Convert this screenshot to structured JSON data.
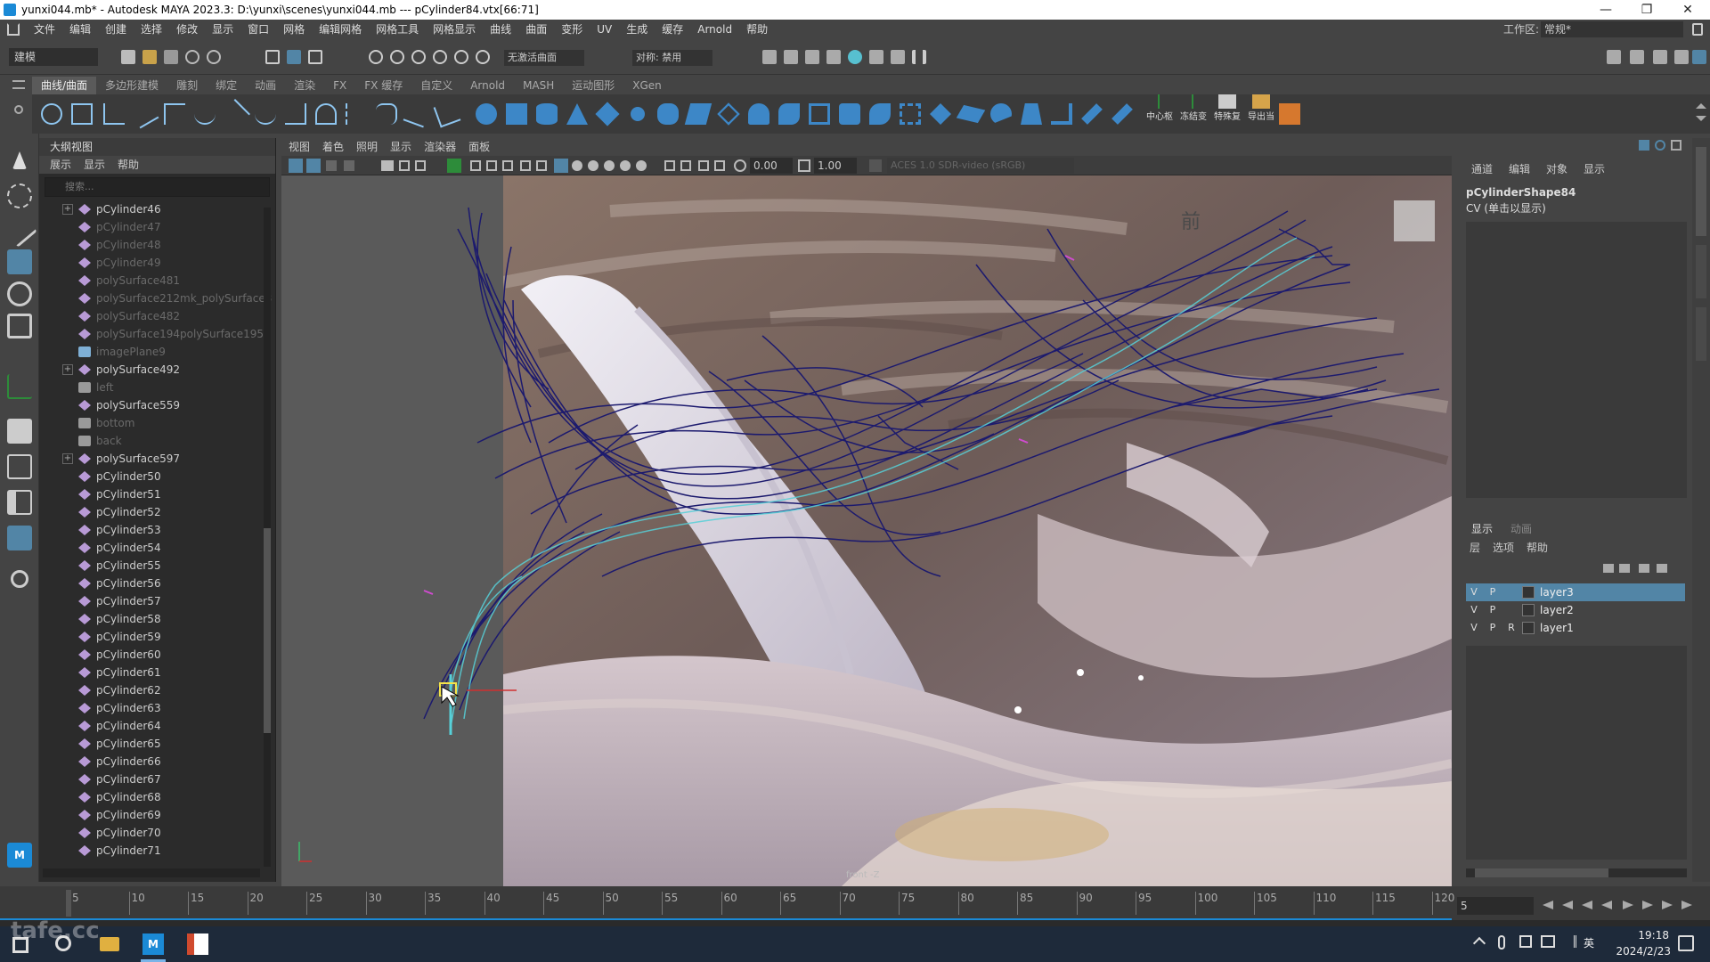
{
  "window": {
    "title": "yunxi044.mb* - Autodesk MAYA 2023.3: D:\\yunxi\\scenes\\yunxi044.mb  ---  pCylinder84.vtx[66:71]",
    "minimize": "—",
    "maximize": "❐",
    "close": "✕"
  },
  "menubar": [
    "文件",
    "编辑",
    "创建",
    "选择",
    "修改",
    "显示",
    "窗口",
    "网格",
    "编辑网格",
    "网格工具",
    "网格显示",
    "曲线",
    "曲面",
    "变形",
    "UV",
    "生成",
    "缓存",
    "Arnold",
    "帮助"
  ],
  "workspace": {
    "label": "工作区:",
    "value": "常规*"
  },
  "statusline": {
    "mode": "建模",
    "live_surface": "无激活曲面",
    "symmetry": "对称: 禁用"
  },
  "shelf_tabs": [
    "曲线/曲面",
    "多边形建模",
    "雕刻",
    "绑定",
    "动画",
    "渲染",
    "FX",
    "FX 缓存",
    "自定义",
    "Arnold",
    "MASH",
    "运动图形",
    "XGen"
  ],
  "shelf_text": [
    "中心枢",
    "冻结变",
    "特殊复",
    "导出当"
  ],
  "outliner": {
    "title": "大纲视图",
    "menu": [
      "展示",
      "显示",
      "帮助"
    ],
    "search_placeholder": "搜索...",
    "items": [
      {
        "label": "pCylinder46",
        "expand": "+",
        "type": "mesh",
        "dim": false
      },
      {
        "label": "pCylinder47",
        "expand": "",
        "type": "mesh",
        "dim": true
      },
      {
        "label": "pCylinder48",
        "expand": "",
        "type": "mesh",
        "dim": true
      },
      {
        "label": "pCylinder49",
        "expand": "",
        "type": "mesh",
        "dim": true
      },
      {
        "label": "polySurface481",
        "expand": "",
        "type": "mesh",
        "dim": true
      },
      {
        "label": "polySurface212mk_polySurface3",
        "expand": "",
        "type": "mesh",
        "dim": true
      },
      {
        "label": "polySurface482",
        "expand": "",
        "type": "mesh",
        "dim": true
      },
      {
        "label": "polySurface194polySurface195",
        "expand": "",
        "type": "mesh",
        "dim": true
      },
      {
        "label": "imagePlane9",
        "expand": "",
        "type": "image",
        "dim": true
      },
      {
        "label": "polySurface492",
        "expand": "+",
        "type": "mesh",
        "dim": false
      },
      {
        "label": "left",
        "expand": "",
        "type": "camera",
        "dim": true
      },
      {
        "label": "polySurface559",
        "expand": "",
        "type": "mesh",
        "dim": false
      },
      {
        "label": "bottom",
        "expand": "",
        "type": "camera",
        "dim": true
      },
      {
        "label": "back",
        "expand": "",
        "type": "camera",
        "dim": true
      },
      {
        "label": "polySurface597",
        "expand": "+",
        "type": "mesh",
        "dim": false
      },
      {
        "label": "pCylinder50",
        "expand": "",
        "type": "mesh",
        "dim": false
      },
      {
        "label": "pCylinder51",
        "expand": "",
        "type": "mesh",
        "dim": false
      },
      {
        "label": "pCylinder52",
        "expand": "",
        "type": "mesh",
        "dim": false
      },
      {
        "label": "pCylinder53",
        "expand": "",
        "type": "mesh",
        "dim": false
      },
      {
        "label": "pCylinder54",
        "expand": "",
        "type": "mesh",
        "dim": false
      },
      {
        "label": "pCylinder55",
        "expand": "",
        "type": "mesh",
        "dim": false
      },
      {
        "label": "pCylinder56",
        "expand": "",
        "type": "mesh",
        "dim": false
      },
      {
        "label": "pCylinder57",
        "expand": "",
        "type": "mesh",
        "dim": false
      },
      {
        "label": "pCylinder58",
        "expand": "",
        "type": "mesh",
        "dim": false
      },
      {
        "label": "pCylinder59",
        "expand": "",
        "type": "mesh",
        "dim": false
      },
      {
        "label": "pCylinder60",
        "expand": "",
        "type": "mesh",
        "dim": false
      },
      {
        "label": "pCylinder61",
        "expand": "",
        "type": "mesh",
        "dim": false
      },
      {
        "label": "pCylinder62",
        "expand": "",
        "type": "mesh",
        "dim": false
      },
      {
        "label": "pCylinder63",
        "expand": "",
        "type": "mesh",
        "dim": false
      },
      {
        "label": "pCylinder64",
        "expand": "",
        "type": "mesh",
        "dim": false
      },
      {
        "label": "pCylinder65",
        "expand": "",
        "type": "mesh",
        "dim": false
      },
      {
        "label": "pCylinder66",
        "expand": "",
        "type": "mesh",
        "dim": false
      },
      {
        "label": "pCylinder67",
        "expand": "",
        "type": "mesh",
        "dim": false
      },
      {
        "label": "pCylinder68",
        "expand": "",
        "type": "mesh",
        "dim": false
      },
      {
        "label": "pCylinder69",
        "expand": "",
        "type": "mesh",
        "dim": false
      },
      {
        "label": "pCylinder70",
        "expand": "",
        "type": "mesh",
        "dim": false
      },
      {
        "label": "pCylinder71",
        "expand": "",
        "type": "mesh",
        "dim": false
      }
    ]
  },
  "viewport": {
    "menu": [
      "视图",
      "着色",
      "照明",
      "显示",
      "渲染器",
      "面板"
    ],
    "field1": "0.00",
    "field2": "1.00",
    "colorspace": "ACES 1.0 SDR-video (sRGB)",
    "view_label": "前",
    "camera_label": "front -Z"
  },
  "channelbox": {
    "tabs": [
      "通道",
      "编辑",
      "对象",
      "显示"
    ],
    "shape": "pCylinderShape84",
    "cv": "CV (单击以显示)"
  },
  "layers": {
    "tabs": [
      "显示",
      "动画"
    ],
    "menu": [
      "层",
      "选项",
      "帮助"
    ],
    "rows": [
      {
        "v": "V",
        "p": "P",
        "r": "",
        "name": "layer3",
        "selected": true
      },
      {
        "v": "V",
        "p": "P",
        "r": "",
        "name": "layer2",
        "selected": false
      },
      {
        "v": "V",
        "p": "P",
        "r": "R",
        "name": "layer1",
        "selected": false
      }
    ]
  },
  "timeslider": {
    "ticks": [
      "5",
      "10",
      "15",
      "20",
      "25",
      "30",
      "35",
      "40",
      "45",
      "50",
      "55",
      "60",
      "65",
      "70",
      "75",
      "80",
      "85",
      "90",
      "95",
      "100",
      "105",
      "110",
      "115",
      "120"
    ],
    "current": "5"
  },
  "taskbar": {
    "time": "19:18",
    "date": "2024/2/23",
    "ime": "英"
  },
  "watermark": "tafe.cc",
  "colors": {
    "accent": "#5285a6",
    "curve": "#1c1a6e",
    "highlight": "#57d0d8"
  }
}
